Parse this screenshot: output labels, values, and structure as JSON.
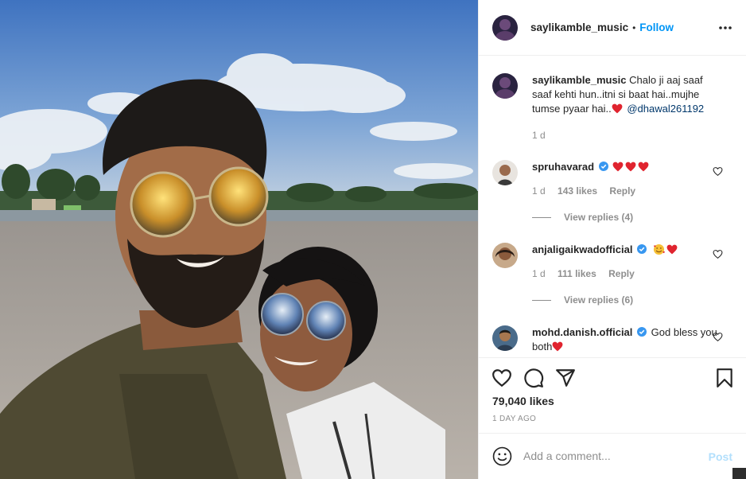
{
  "post": {
    "author": "saylikamble_music",
    "follow_label": "Follow",
    "dot": "•",
    "caption_author": "saylikamble_music",
    "caption_text": "Chalo ji aaj saaf saaf kehti hun..itni si baat hai..mujhe tumse pyaar hai..",
    "caption_mention": "@dhawal261192",
    "caption_time": "1 d",
    "likes": "79,040 likes",
    "time_ago": "1 DAY AGO"
  },
  "comments": [
    {
      "username": "spruhavarad",
      "verified": true,
      "text": "",
      "emojis": [
        "red-heart",
        "red-heart",
        "red-heart"
      ],
      "time": "1 d",
      "likes": "143 likes",
      "reply": "Reply",
      "view_replies": "View replies (4)"
    },
    {
      "username": "anjaligaikwadofficial",
      "verified": true,
      "text": "",
      "emojis": [
        "smiling-face-with-hearts",
        "red-heart"
      ],
      "time": "1 d",
      "likes": "111 likes",
      "reply": "Reply",
      "view_replies": "View replies (6)"
    },
    {
      "username": "mohd.danish.official",
      "verified": true,
      "text": "God bless you both",
      "emojis": [
        "red-heart"
      ]
    }
  ],
  "add_comment": {
    "placeholder": "Add a comment...",
    "post_label": "Post"
  },
  "icons": {
    "more": "more-horizontal-icon",
    "like": "heart-outline-icon",
    "comment": "comment-bubble-icon",
    "share": "paper-plane-icon",
    "save": "bookmark-icon",
    "emoji": "smiley-icon",
    "verified": "verified-badge-icon"
  },
  "colors": {
    "accent": "#0095f6",
    "verified": "#3897f0",
    "heart": "#ed4956",
    "post_disabled": "#b2dffc",
    "muted": "#8e8e8e"
  }
}
